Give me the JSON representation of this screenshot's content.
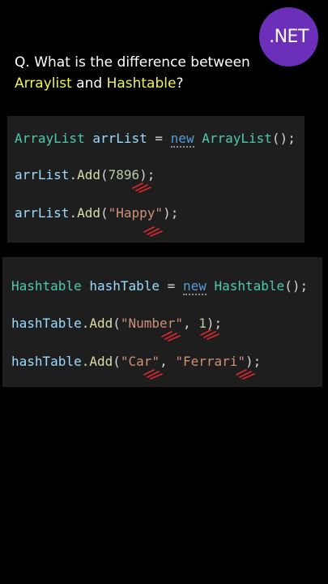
{
  "logo": {
    "text": ".NET",
    "color": "#6b2fba"
  },
  "question": {
    "prefix": "Q. What is the difference between",
    "term1": "Arraylist",
    "and": " and ",
    "term2": "Hashtable",
    "suffix": "?"
  },
  "snippet1": {
    "line1": {
      "type": "ArrayList",
      "var": " arrList",
      "eq": " = ",
      "kw": "new",
      "sp": " ",
      "ctor": "ArrayList",
      "end": "();"
    },
    "line2": {
      "obj": "arrList",
      "dot": ".",
      "method": "Add",
      "open": "(",
      "arg": "7896",
      "close": ");"
    },
    "line3": {
      "obj": "arrList",
      "dot": ".",
      "method": "Add",
      "open": "(",
      "arg": "\"Happy\"",
      "close": ");"
    }
  },
  "snippet2": {
    "line1": {
      "type": "Hashtable",
      "var": " hashTable",
      "eq": " = ",
      "kw": "new",
      "sp": " ",
      "ctor": "Hashtable",
      "end": "();"
    },
    "line2": {
      "obj": "hashTable",
      "dot": ".",
      "method": "Add",
      "open": "(",
      "arg1": "\"Number\"",
      "comma": ", ",
      "arg2": "1",
      "close": ");"
    },
    "line3": {
      "obj": "hashTable",
      "dot": ".",
      "method": "Add",
      "open": "(",
      "arg1": "\"Car\"",
      "comma": ", ",
      "arg2": "\"Ferrari\"",
      "close": ");"
    }
  },
  "colors": {
    "highlight": "#f1f35a",
    "type": "#4ec9b0",
    "variable": "#9cdcfe",
    "keyword": "#569cd6",
    "method": "#dcdcaa",
    "number": "#b5cea8",
    "string": "#ce9178",
    "annotation": "#e0282d"
  }
}
